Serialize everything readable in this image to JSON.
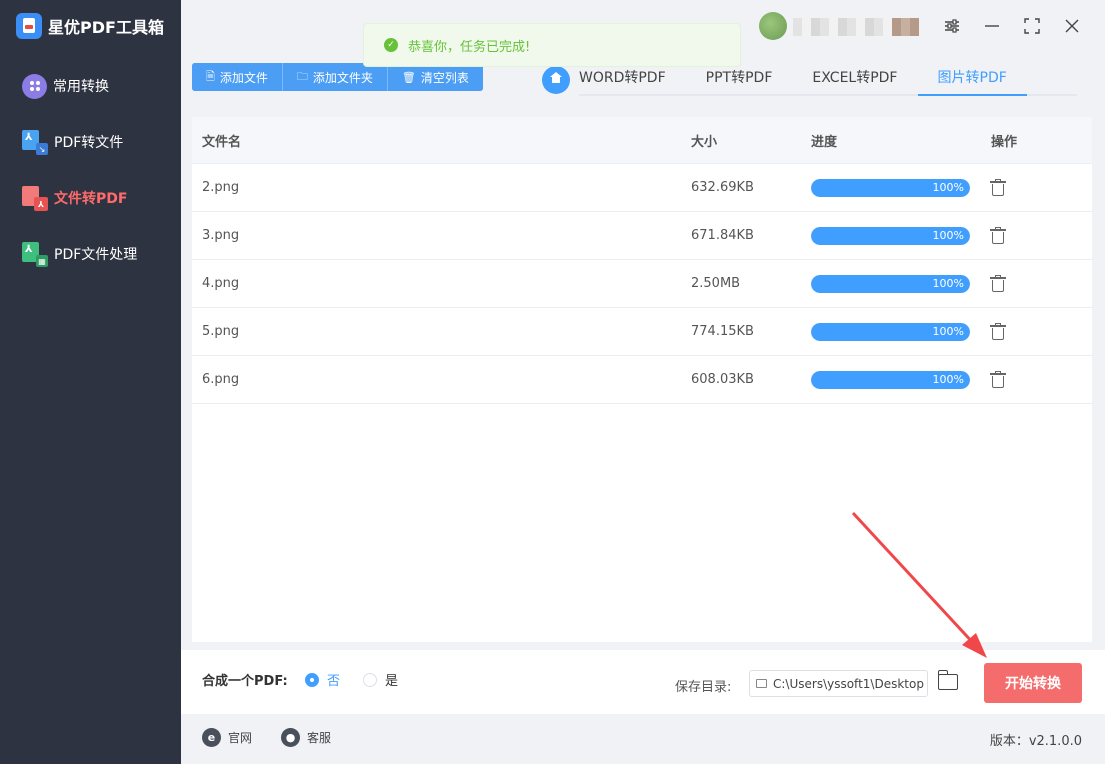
{
  "app": {
    "title": "星优PDF工具箱"
  },
  "sidebar": {
    "items": [
      {
        "label": "常用转换",
        "icon": "grid-circle-icon",
        "active": false
      },
      {
        "label": "PDF转文件",
        "icon": "pdf-to-file-icon",
        "active": false
      },
      {
        "label": "文件转PDF",
        "icon": "file-to-pdf-icon",
        "active": true
      },
      {
        "label": "PDF文件处理",
        "icon": "pdf-process-icon",
        "active": false
      }
    ]
  },
  "toast": {
    "message": "恭喜你，任务已完成!"
  },
  "toolbar": {
    "add_file": "添加文件",
    "add_folder": "添加文件夹",
    "clear_list": "清空列表"
  },
  "tabs": [
    {
      "label": "WORD转PDF",
      "active": false
    },
    {
      "label": "PPT转PDF",
      "active": false
    },
    {
      "label": "EXCEL转PDF",
      "active": false
    },
    {
      "label": "图片转PDF",
      "active": true
    }
  ],
  "table": {
    "headers": {
      "name": "文件名",
      "size": "大小",
      "progress": "进度",
      "action": "操作"
    },
    "rows": [
      {
        "name": "2.png",
        "size": "632.69KB",
        "progress": 100,
        "progress_label": "100%"
      },
      {
        "name": "3.png",
        "size": "671.84KB",
        "progress": 100,
        "progress_label": "100%"
      },
      {
        "name": "4.png",
        "size": "2.50MB",
        "progress": 100,
        "progress_label": "100%"
      },
      {
        "name": "5.png",
        "size": "774.15KB",
        "progress": 100,
        "progress_label": "100%"
      },
      {
        "name": "6.png",
        "size": "608.03KB",
        "progress": 100,
        "progress_label": "100%"
      }
    ]
  },
  "bottom": {
    "merge_label": "合成一个PDF:",
    "option_no": "否",
    "option_yes": "是",
    "selected": "否",
    "save_dir_label": "保存目录:",
    "save_dir_value": "C:\\Users\\yssoft1\\Desktop",
    "start_button": "开始转换"
  },
  "footer": {
    "website": "官网",
    "support": "客服",
    "version": "版本：v2.1.0.0"
  },
  "colors": {
    "sidebar_bg": "#2e3341",
    "accent": "#409eff",
    "start_button": "#f56c6c",
    "active_nav": "#ff6b6b",
    "toast_text": "#67c23a",
    "annotation_arrow": "#f0484a"
  }
}
